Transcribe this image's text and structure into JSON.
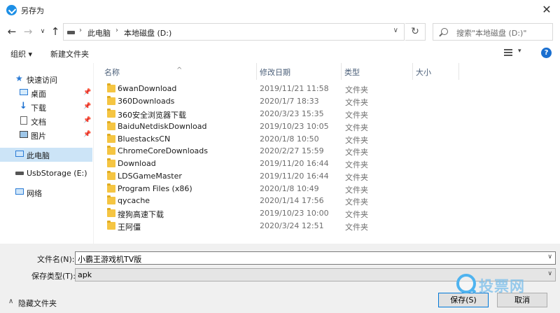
{
  "window": {
    "title": "另存为",
    "close_glyph": "✕"
  },
  "address": {
    "back": "←",
    "forward": "→",
    "recent": "∨",
    "up": "↑",
    "segments": [
      "此电脑",
      "本地磁盘 (D:)"
    ],
    "separator": "›",
    "dropdown": "∨",
    "refresh": "↻",
    "search_placeholder": "搜索\"本地磁盘 (D:)\""
  },
  "toolbar": {
    "organize": "组织 ▾",
    "new_folder": "新建文件夹",
    "view_dropdown": "▾",
    "help": "?"
  },
  "sidebar": {
    "items": [
      {
        "label": "快速访问",
        "icon": "star-icon"
      },
      {
        "label": "桌面",
        "icon": "desktop-icon",
        "pinned": true
      },
      {
        "label": "下载",
        "icon": "download-icon",
        "pinned": true
      },
      {
        "label": "文档",
        "icon": "document-icon",
        "pinned": true
      },
      {
        "label": "图片",
        "icon": "pictures-icon",
        "pinned": true
      },
      {
        "label": "此电脑",
        "icon": "computer-icon",
        "selected": true
      },
      {
        "label": "UsbStorage (E:)",
        "icon": "usb-drive-icon"
      },
      {
        "label": "网络",
        "icon": "network-icon"
      }
    ],
    "pin_glyph": "📌"
  },
  "columns": {
    "name": "名称",
    "date": "修改日期",
    "type": "类型",
    "size": "大小",
    "sort_glyph": "^"
  },
  "files": [
    {
      "name": "6wanDownload",
      "date": "2019/11/21 11:58",
      "type": "文件夹"
    },
    {
      "name": "360Downloads",
      "date": "2020/1/7 18:33",
      "type": "文件夹"
    },
    {
      "name": "360安全浏览器下载",
      "date": "2020/3/23 15:35",
      "type": "文件夹"
    },
    {
      "name": "BaiduNetdiskDownload",
      "date": "2019/10/23 10:05",
      "type": "文件夹"
    },
    {
      "name": "BluestacksCN",
      "date": "2020/1/8 10:50",
      "type": "文件夹"
    },
    {
      "name": "ChromeCoreDownloads",
      "date": "2020/2/27 15:59",
      "type": "文件夹"
    },
    {
      "name": "Download",
      "date": "2019/11/20 16:44",
      "type": "文件夹"
    },
    {
      "name": "LDSGameMaster",
      "date": "2019/11/20 16:44",
      "type": "文件夹"
    },
    {
      "name": "Program Files (x86)",
      "date": "2020/1/8 10:49",
      "type": "文件夹"
    },
    {
      "name": "qycache",
      "date": "2020/1/14 17:56",
      "type": "文件夹"
    },
    {
      "name": "搜狗高速下载",
      "date": "2019/10/23 10:00",
      "type": "文件夹"
    },
    {
      "name": "王阿僵",
      "date": "2020/3/24 12:51",
      "type": "文件夹"
    }
  ],
  "form": {
    "filename_label": "文件名(N):",
    "filename_value": "小霸王游戏机TV版",
    "filetype_label": "保存类型(T):",
    "filetype_value": "apk",
    "dropdown": "∨"
  },
  "footer": {
    "hide_folders_chevron": "∧",
    "hide_folders": "隐藏文件夹",
    "save": "保存(S)",
    "cancel": "取消"
  },
  "watermark": {
    "text": "投票网"
  },
  "colors": {
    "accent": "#0078d7",
    "folder": "#f5c542",
    "selected": "#cce4f7"
  }
}
